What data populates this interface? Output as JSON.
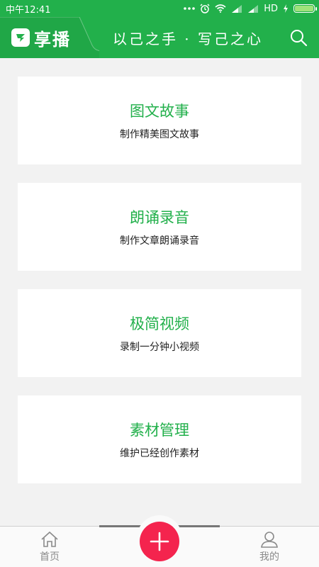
{
  "status_bar": {
    "time": "中午12:41",
    "network": "HD",
    "battery_level": 1.0
  },
  "header": {
    "app_name": "享播",
    "tagline": "以己之手 · 写己之心",
    "search_icon": "search-icon"
  },
  "cards": [
    {
      "title": "图文故事",
      "subtitle": "制作精美图文故事"
    },
    {
      "title": "朗诵录音",
      "subtitle": "制作文章朗诵录音"
    },
    {
      "title": "极简视频",
      "subtitle": "录制一分钟小视频"
    },
    {
      "title": "素材管理",
      "subtitle": "维护已经创作素材"
    }
  ],
  "bottom_nav": {
    "home_label": "首页",
    "mine_label": "我的",
    "add_icon": "plus-icon"
  },
  "colors": {
    "brand_green": "#22b04b",
    "add_button_red": "#f4244e"
  }
}
